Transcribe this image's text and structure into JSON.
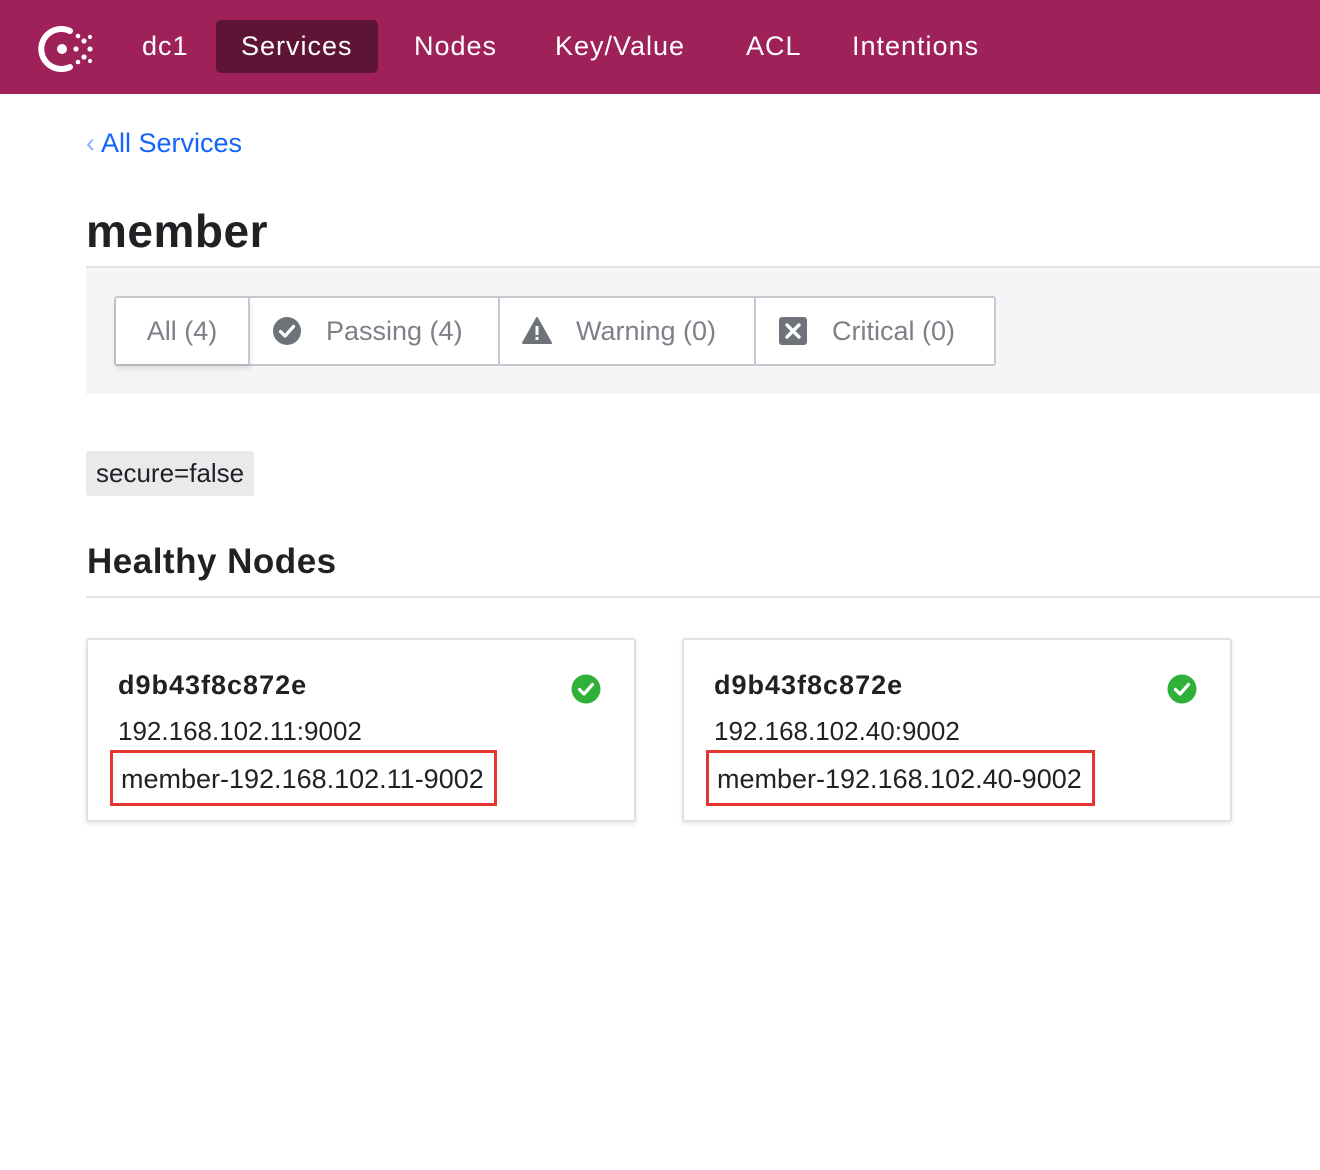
{
  "nav": {
    "logo": "consul-logo-icon",
    "datacenter": "dc1",
    "items": [
      {
        "label": "Services",
        "active": true
      },
      {
        "label": "Nodes",
        "active": false
      },
      {
        "label": "Key/Value",
        "active": false
      },
      {
        "label": "ACL",
        "active": false
      },
      {
        "label": "Intentions",
        "active": false
      }
    ]
  },
  "breadcrumb": {
    "label": "All Services",
    "icon": "chevron-left-icon"
  },
  "page": {
    "title": "member"
  },
  "filters": [
    {
      "label": "All (4)",
      "icon": "",
      "selected": true
    },
    {
      "label": "Passing (4)",
      "icon": "check-circle-icon",
      "selected": false
    },
    {
      "label": "Warning (0)",
      "icon": "warning-triangle-icon",
      "selected": false
    },
    {
      "label": "Critical (0)",
      "icon": "x-square-icon",
      "selected": false
    }
  ],
  "tags": [
    "secure=false"
  ],
  "section": {
    "title": "Healthy Nodes"
  },
  "nodes": [
    {
      "name": "d9b43f8c872e",
      "address": "192.168.102.11:9002",
      "service_id": "member-192.168.102.11-9002",
      "status": "passing"
    },
    {
      "name": "d9b43f8c872e",
      "address": "192.168.102.40:9002",
      "service_id": "member-192.168.102.40-9002",
      "status": "passing"
    }
  ],
  "colors": {
    "nav_bg": "#9e2159",
    "nav_active_bg": "#5e1435",
    "link": "#1563ff",
    "passing": "#2eb039",
    "highlight_box": "#e3342f"
  }
}
